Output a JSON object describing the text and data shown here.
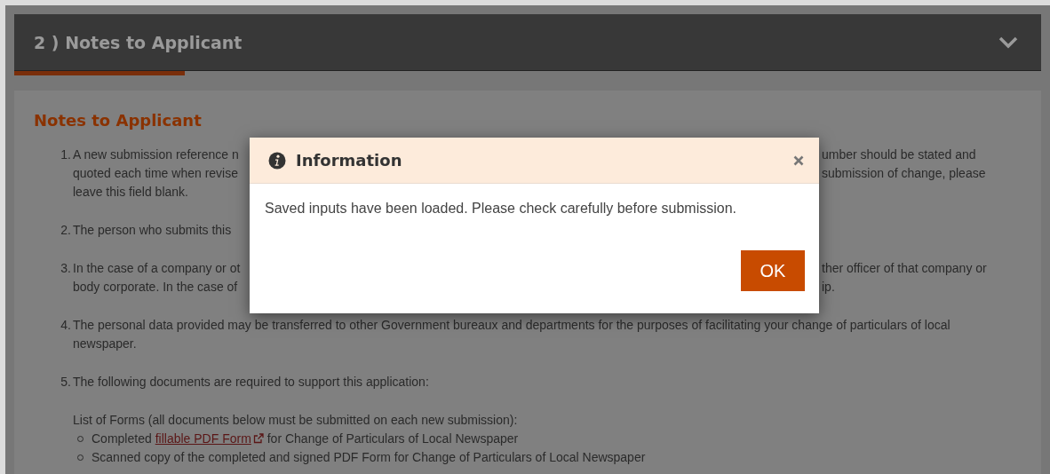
{
  "section": {
    "title": "2 ) Notes to Applicant"
  },
  "notes": {
    "heading": "Notes to Applicant",
    "items": [
      {
        "number": "1.",
        "lines": [
          {
            "left": "A new submission reference n",
            "right": "umber should be stated and"
          },
          {
            "left": "quoted each time when revise",
            "right": "submission of change, please"
          },
          {
            "left": "leave this field blank."
          }
        ]
      },
      {
        "number": "2.",
        "lines": [
          {
            "left": "The person who submits this"
          }
        ]
      },
      {
        "number": "3.",
        "lines": [
          {
            "left": "In the case of a company or ot",
            "right": "ther officer of that company or"
          },
          {
            "left": "body corporate. In the case of",
            "right": "ip."
          }
        ]
      },
      {
        "number": "4.",
        "text": "The personal data provided may be transferred to other Government bureaux and departments for the purposes of facilitating your change of particulars of local newspaper."
      },
      {
        "number": "5.",
        "text": "The following documents are required to support this application:",
        "list_title": "List of Forms (all documents below must be submitted on each new submission):",
        "bullets": [
          {
            "before": "Completed",
            "link": "fillable PDF Form",
            "after": "for Change of Particulars of Local Newspaper"
          },
          {
            "before": "Scanned copy of the completed and signed PDF Form for Change of Particulars of Local Newspaper"
          }
        ]
      }
    ]
  },
  "dialog": {
    "title": "Information",
    "message": "Saved inputs have been loaded. Please check carefully before submission.",
    "button": "OK"
  }
}
